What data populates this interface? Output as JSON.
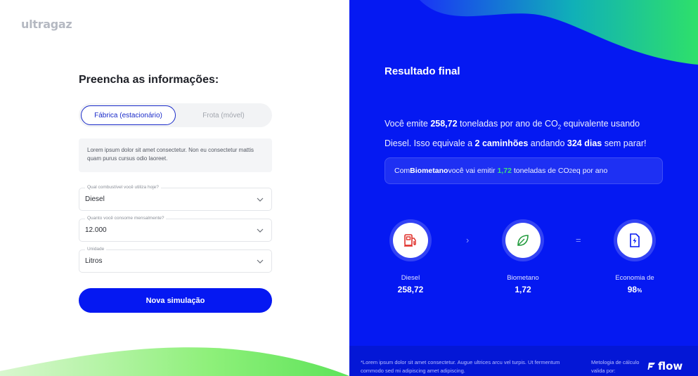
{
  "brand": {
    "logo_text": "ultragaz"
  },
  "form": {
    "title": "Preencha as informações:",
    "toggle": {
      "active": "Fábrica (estacionário)",
      "inactive": "Frota (móvel)"
    },
    "info_text": "Lorem ipsum dolor sit amet consectetur. Non eu consectetur mattis quam purus cursus odio laoreet.",
    "fields": [
      {
        "label": "Qual combustível você utiliza hoje?",
        "value": "Diesel"
      },
      {
        "label": "Quanto você consome mensalmente?",
        "value": "12.000"
      },
      {
        "label": "Unidade",
        "value": "Litros"
      }
    ],
    "button_label": "Nova simulação"
  },
  "result": {
    "title": "Resultado final",
    "summary": {
      "p1": "Você emite ",
      "tonnes": "258,72",
      "p2": " toneladas por ano de CO",
      "sub": "2",
      "p3": " equivalente usando Diesel. Isso equivale a ",
      "trucks": "2 caminhões",
      "p4": " andando ",
      "days": "324 dias",
      "p5": " sem parar!"
    },
    "biomethane_box": {
      "p1": "Com ",
      "fuel": "Biometano",
      "p2": " você vai emitir ",
      "value": "1,72",
      "p3": " toneladas de CO",
      "sub": "2",
      "p4": "eq por ano"
    },
    "metrics": [
      {
        "icon": "fuel-pump-icon",
        "label": "Diesel",
        "value": "258,72",
        "unit": ""
      },
      {
        "icon": "leaf-icon",
        "label": "Biometano",
        "value": "1,72",
        "unit": ""
      },
      {
        "icon": "energy-document-icon",
        "label": "Economia de",
        "value": "98",
        "unit": "%"
      }
    ],
    "operators": {
      "arrow": "›",
      "equals": "="
    },
    "footer": {
      "note": "*Lorem ipsum dolor sit amet consectetur. Augue ultrices arcu vel turpis. Ut fermentum commodo sed mi adipiscing amet adipiscing.",
      "methodology": "Metologia de cálculo valida por:",
      "partner_logo": "flow"
    }
  },
  "colors": {
    "primary": "#0519f2",
    "accent_green": "#3ee07a",
    "icon_red": "#e0302a",
    "icon_green": "#1f9a3a",
    "icon_blue": "#0519f2"
  }
}
